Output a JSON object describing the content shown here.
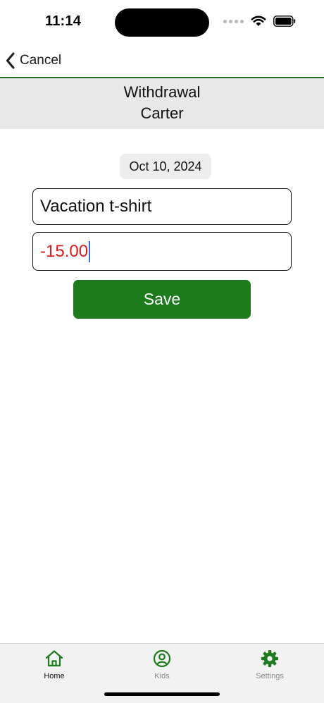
{
  "status_bar": {
    "time": "11:14",
    "icons": [
      "signal-dots-icon",
      "wifi-icon",
      "battery-icon"
    ]
  },
  "nav": {
    "back_label": "Cancel",
    "back_icon": "chevron-left-icon",
    "divider_color": "#1f6b1f"
  },
  "header": {
    "title": "Withdrawal",
    "subtitle": "Carter"
  },
  "form": {
    "date": "Oct 10, 2024",
    "description_value": "Vacation t-shirt",
    "amount_value": "-15.00",
    "amount_color": "#e01b1b",
    "save_label": "Save",
    "save_color": "#1d7a1d"
  },
  "tabs": [
    {
      "label": "Home",
      "icon": "home-icon",
      "active": true
    },
    {
      "label": "Kids",
      "icon": "person-circle-icon",
      "active": false
    },
    {
      "label": "Settings",
      "icon": "gear-icon",
      "active": false
    }
  ],
  "accent_color": "#1d7a1d"
}
